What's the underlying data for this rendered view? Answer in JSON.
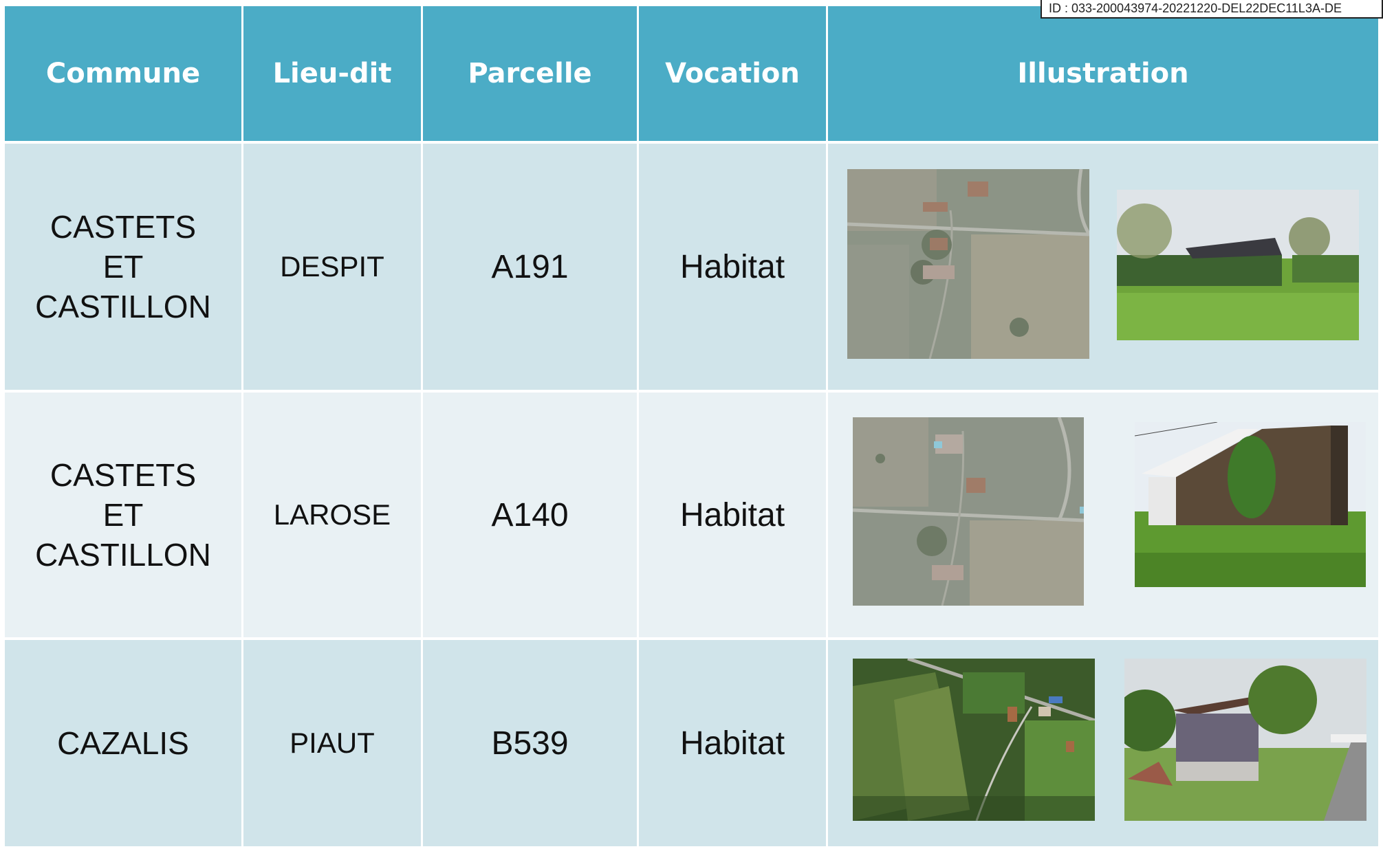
{
  "stamp": {
    "text": "ID : 033-200043974-20221220-DEL22DEC11L3A-DE"
  },
  "table": {
    "headers": [
      "Commune",
      "Lieu-dit",
      "Parcelle",
      "Vocation",
      "Illustration"
    ],
    "rows": [
      {
        "commune": "CASTETS ET CASTILLON",
        "lieu_dit": "DESPIT",
        "parcelle": "A191",
        "vocation": "Habitat",
        "illustrations": [
          "aerial-photo",
          "street-view-photo"
        ]
      },
      {
        "commune": "CASTETS ET CASTILLON",
        "lieu_dit": "LAROSE",
        "parcelle": "A140",
        "vocation": "Habitat",
        "illustrations": [
          "aerial-photo",
          "barn-photo"
        ]
      },
      {
        "commune": "CAZALIS",
        "lieu_dit": "PIAUT",
        "parcelle": "B539",
        "vocation": "Habitat",
        "illustrations": [
          "aerial-photo",
          "barn-photo"
        ]
      }
    ]
  },
  "colors": {
    "header_bg": "#4bacc6",
    "row_dark": "#d0e4ea",
    "row_light": "#e9f1f4"
  }
}
